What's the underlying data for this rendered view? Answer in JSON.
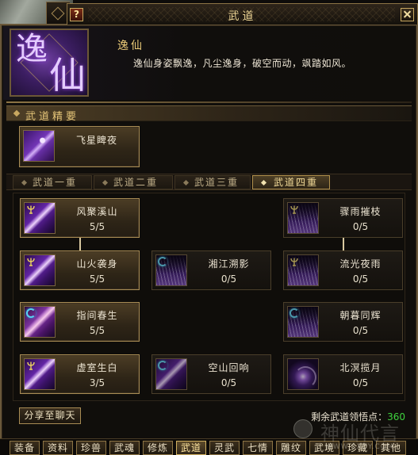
{
  "window": {
    "title": "武道",
    "help_label": "?"
  },
  "header": {
    "emblem": {
      "char_1": "逸",
      "char_2": "仙"
    },
    "name": "逸仙",
    "description": "逸仙身姿飘逸，凡尘逸身，破空而动，飒踏如风。"
  },
  "essence": {
    "section_title": "武道精要",
    "skill": {
      "name": "飞星睥夜",
      "icon": "flying-figure-icon"
    }
  },
  "tabs": [
    {
      "label": "武道一重",
      "active": false
    },
    {
      "label": "武道二重",
      "active": false
    },
    {
      "label": "武道三重",
      "active": false
    },
    {
      "label": "武道四重",
      "active": true
    }
  ],
  "tree": {
    "rows": [
      [
        {
          "name": "风聚溪山",
          "level": "5/5",
          "learned": true,
          "icon": "sword-slash-icon",
          "badge": "trident-badge-icon"
        },
        null,
        {
          "name": "骤雨摧枝",
          "level": "0/5",
          "learned": false,
          "icon": "rain-streak-icon",
          "badge": "trident-badge-icon"
        }
      ],
      [
        {
          "name": "山火袭身",
          "level": "5/5",
          "learned": true,
          "icon": "sword-slash-icon",
          "badge": "trident-badge-icon"
        },
        {
          "name": "湘江溯影",
          "level": "0/5",
          "learned": false,
          "icon": "wave-streak-icon",
          "badge": "moon-badge-icon"
        },
        {
          "name": "流光夜雨",
          "level": "0/5",
          "learned": false,
          "icon": "rain-streak-icon",
          "badge": "trident-badge-icon"
        }
      ],
      [
        {
          "name": "指间春生",
          "level": "5/5",
          "learned": true,
          "icon": "sword-slash-icon",
          "badge": "moon-badge-icon"
        },
        null,
        {
          "name": "朝暮同辉",
          "level": "0/5",
          "learned": false,
          "icon": "wave-streak-icon",
          "badge": "moon-badge-icon"
        }
      ],
      [
        {
          "name": "虚室生白",
          "level": "3/5",
          "learned": true,
          "icon": "sword-slash-icon",
          "badge": "trident-badge-icon"
        },
        {
          "name": "空山回响",
          "level": "0/5",
          "learned": false,
          "icon": "sword-slash-icon",
          "badge": "moon-badge-icon"
        },
        {
          "name": "北溟揽月",
          "level": "0/5",
          "learned": false,
          "icon": "swirl-moon-icon"
        }
      ]
    ]
  },
  "footer": {
    "share_button": "分享至聊天",
    "points_label": "剩余武道领悟点：",
    "points_value": "360"
  },
  "bottom_tabs": [
    {
      "label": "装备",
      "active": false
    },
    {
      "label": "资料",
      "active": false
    },
    {
      "label": "珍兽",
      "active": false
    },
    {
      "label": "武魂",
      "active": false
    },
    {
      "label": "修炼",
      "active": false
    },
    {
      "label": "武道",
      "active": true
    },
    {
      "label": "灵武",
      "active": false
    },
    {
      "label": "七情",
      "active": false
    },
    {
      "label": "雕纹",
      "active": false
    },
    {
      "label": "武境",
      "active": false
    },
    {
      "label": "珍藏",
      "active": false
    },
    {
      "label": "其他",
      "active": false
    }
  ],
  "watermark": {
    "logo_text": "神仙代言",
    "url": "WWW.SXDY.COM"
  },
  "colors": {
    "gold_text": "#eccb78",
    "frame_gold": "#8c7444",
    "panel_bg": "#100e0b",
    "skill_purple": "#6a28b0",
    "points_green": "#3ed33e",
    "moon_badge_cyan": "#58d4f4"
  }
}
